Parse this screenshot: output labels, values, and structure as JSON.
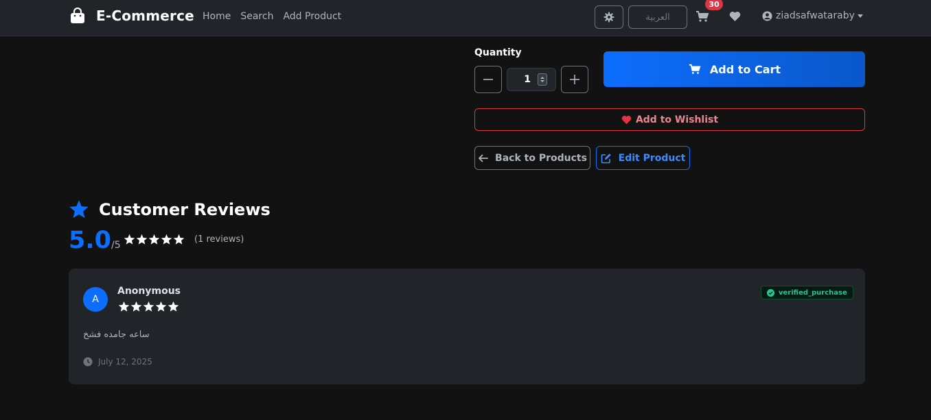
{
  "navbar": {
    "brand": "E-Commerce",
    "links": [
      "Home",
      "Search",
      "Add Product"
    ],
    "language_button": "العربية",
    "cart_count": "30",
    "username": "ziadsafwataraby"
  },
  "product_controls": {
    "quantity_label": "Quantity",
    "quantity_value": "1",
    "add_to_cart": "Add to Cart",
    "add_to_wishlist": "Add to Wishlist",
    "back_to_products": "Back to Products",
    "edit_product": "Edit Product"
  },
  "reviews": {
    "heading": "Customer Reviews",
    "average": "5.0",
    "max": "/5",
    "average_stars": 5,
    "count_text": "(1 reviews)",
    "items": [
      {
        "avatar_letter": "A",
        "author": "Anonymous",
        "stars": 5,
        "badge": "verified_purchase",
        "text": "ساعه جامده فشخ",
        "date": "July 12, 2025"
      }
    ]
  },
  "colors": {
    "primary": "#0d6efd",
    "danger": "#dc3545",
    "success": "#20c997",
    "background": "#121212",
    "card": "#212529"
  },
  "icons": [
    "bag-icon",
    "gear-icon",
    "cart-icon",
    "heart-icon",
    "user-circle-icon",
    "minus-icon",
    "plus-icon",
    "arrow-left-icon",
    "edit-icon",
    "star-icon",
    "check-circle-icon",
    "clock-icon"
  ]
}
